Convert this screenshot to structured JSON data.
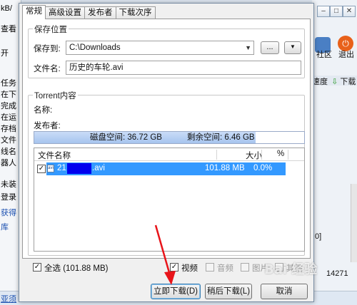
{
  "background": {
    "left_fragments": [
      "kB/",
      "查看",
      "开",
      "任务",
      "在下",
      "完成",
      "在运",
      "存档",
      "文件",
      "线名",
      "器人",
      "未装",
      "登录",
      "获得",
      "库",
      "亚须"
    ],
    "top_window_buttons": [
      "–",
      "□",
      "✕"
    ],
    "right_fragments": [
      "社区",
      "退出",
      "速度",
      "下载",
      "0]",
      "14271"
    ]
  },
  "dialog": {
    "tabs": [
      "常规",
      "高级设置",
      "发布者",
      "下载次序"
    ],
    "save_group": {
      "title": "保存位置",
      "save_to_label": "保存到:",
      "save_to_value": "C:\\Downloads",
      "browse_label": "...",
      "menu_label": "▼",
      "filename_label": "文件名:",
      "filename_value": "历史的车轮.avi"
    },
    "torrent_group": {
      "title": "Torrent内容",
      "name_label": "名称:",
      "publisher_label": "发布者:",
      "disk_space_label": "磁盘空间: 36.72 GB",
      "remaining_space_label": "剩余空间: 6.46 GB",
      "disk_fill_fraction": 0.82,
      "file_list": {
        "columns": [
          "文件名称",
          "大小",
          "%"
        ],
        "rows": [
          {
            "checked": true,
            "icon": "avi",
            "name_prefix": "21",
            "name_suffix": ".avi",
            "size": "101.88 MB",
            "percent": "0.0%"
          }
        ]
      }
    },
    "footer": {
      "select_all_label": "全选 (101.88 MB)",
      "select_all_checked": true,
      "filters": [
        {
          "label": "视频",
          "checked": true,
          "enabled": true
        },
        {
          "label": "音频",
          "checked": false,
          "enabled": false
        },
        {
          "label": "图片",
          "checked": false,
          "enabled": false
        },
        {
          "label": "其他",
          "checked": false,
          "enabled": false
        }
      ]
    },
    "buttons": {
      "download_now": "立即下载(D)",
      "download_later": "稍后下载(L)",
      "cancel": "取消"
    }
  },
  "watermark": "Bai 经验",
  "colors": {
    "selection": "#3399ff",
    "annotation_arrow": "#e8141a"
  }
}
